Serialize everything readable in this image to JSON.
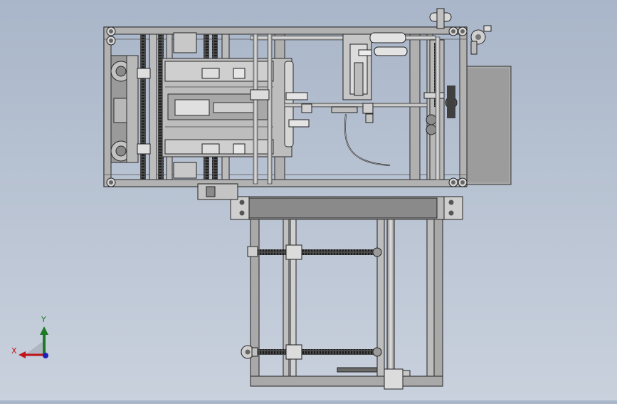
{
  "view": {
    "background_top": "#a9b6c9",
    "background_bottom": "#c9d1dd",
    "line_color": "#2b2b2b",
    "frame_fill": "#a3a3a3",
    "panel_fill": "#8f8f8f",
    "part_fill": "#c4c4c4",
    "chain_color": "#1e1e1e"
  },
  "triad": {
    "x_label": "X",
    "y_label": "Y",
    "x_color": "#c0151a",
    "y_color": "#1c7a25",
    "z_color": "#1a22b8"
  }
}
